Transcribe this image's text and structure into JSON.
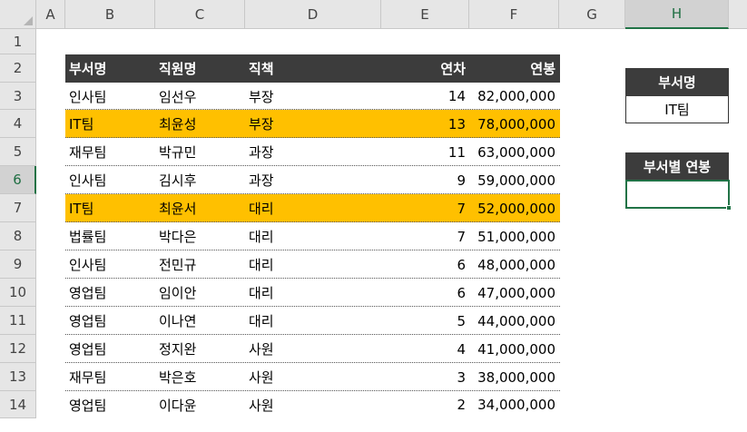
{
  "columns": [
    "A",
    "B",
    "C",
    "D",
    "E",
    "F",
    "G",
    "H"
  ],
  "rows": [
    "1",
    "2",
    "3",
    "4",
    "5",
    "6",
    "7",
    "8",
    "9",
    "10",
    "11",
    "12",
    "13",
    "14"
  ],
  "table": {
    "headers": [
      "부서명",
      "직원명",
      "직책",
      "연차",
      "연봉"
    ],
    "rows": [
      {
        "dept": "인사팀",
        "name": "임선우",
        "title": "부장",
        "years": "14",
        "salary": "82,000,000",
        "highlight": false
      },
      {
        "dept": "IT팀",
        "name": "최윤성",
        "title": "부장",
        "years": "13",
        "salary": "78,000,000",
        "highlight": true
      },
      {
        "dept": "재무팀",
        "name": "박규민",
        "title": "과장",
        "years": "11",
        "salary": "63,000,000",
        "highlight": false
      },
      {
        "dept": "인사팀",
        "name": "김시후",
        "title": "과장",
        "years": "9",
        "salary": "59,000,000",
        "highlight": false
      },
      {
        "dept": "IT팀",
        "name": "최윤서",
        "title": "대리",
        "years": "7",
        "salary": "52,000,000",
        "highlight": true
      },
      {
        "dept": "법률팀",
        "name": "박다은",
        "title": "대리",
        "years": "7",
        "salary": "51,000,000",
        "highlight": false
      },
      {
        "dept": "인사팀",
        "name": "전민규",
        "title": "대리",
        "years": "6",
        "salary": "48,000,000",
        "highlight": false
      },
      {
        "dept": "영업팀",
        "name": "임이안",
        "title": "대리",
        "years": "6",
        "salary": "47,000,000",
        "highlight": false
      },
      {
        "dept": "영업팀",
        "name": "이나연",
        "title": "대리",
        "years": "5",
        "salary": "44,000,000",
        "highlight": false
      },
      {
        "dept": "영업팀",
        "name": "정지완",
        "title": "사원",
        "years": "4",
        "salary": "41,000,000",
        "highlight": false
      },
      {
        "dept": "재무팀",
        "name": "박은호",
        "title": "사원",
        "years": "3",
        "salary": "38,000,000",
        "highlight": false
      },
      {
        "dept": "영업팀",
        "name": "이다윤",
        "title": "사원",
        "years": "2",
        "salary": "34,000,000",
        "highlight": false
      }
    ]
  },
  "lookup": {
    "dept_label": "부서명",
    "dept_value": "IT팀",
    "salary_label": "부서별 연봉",
    "salary_value": ""
  },
  "colors": {
    "header_bg": "#3c3c3c",
    "highlight": "#ffc000",
    "selection": "#217346"
  }
}
